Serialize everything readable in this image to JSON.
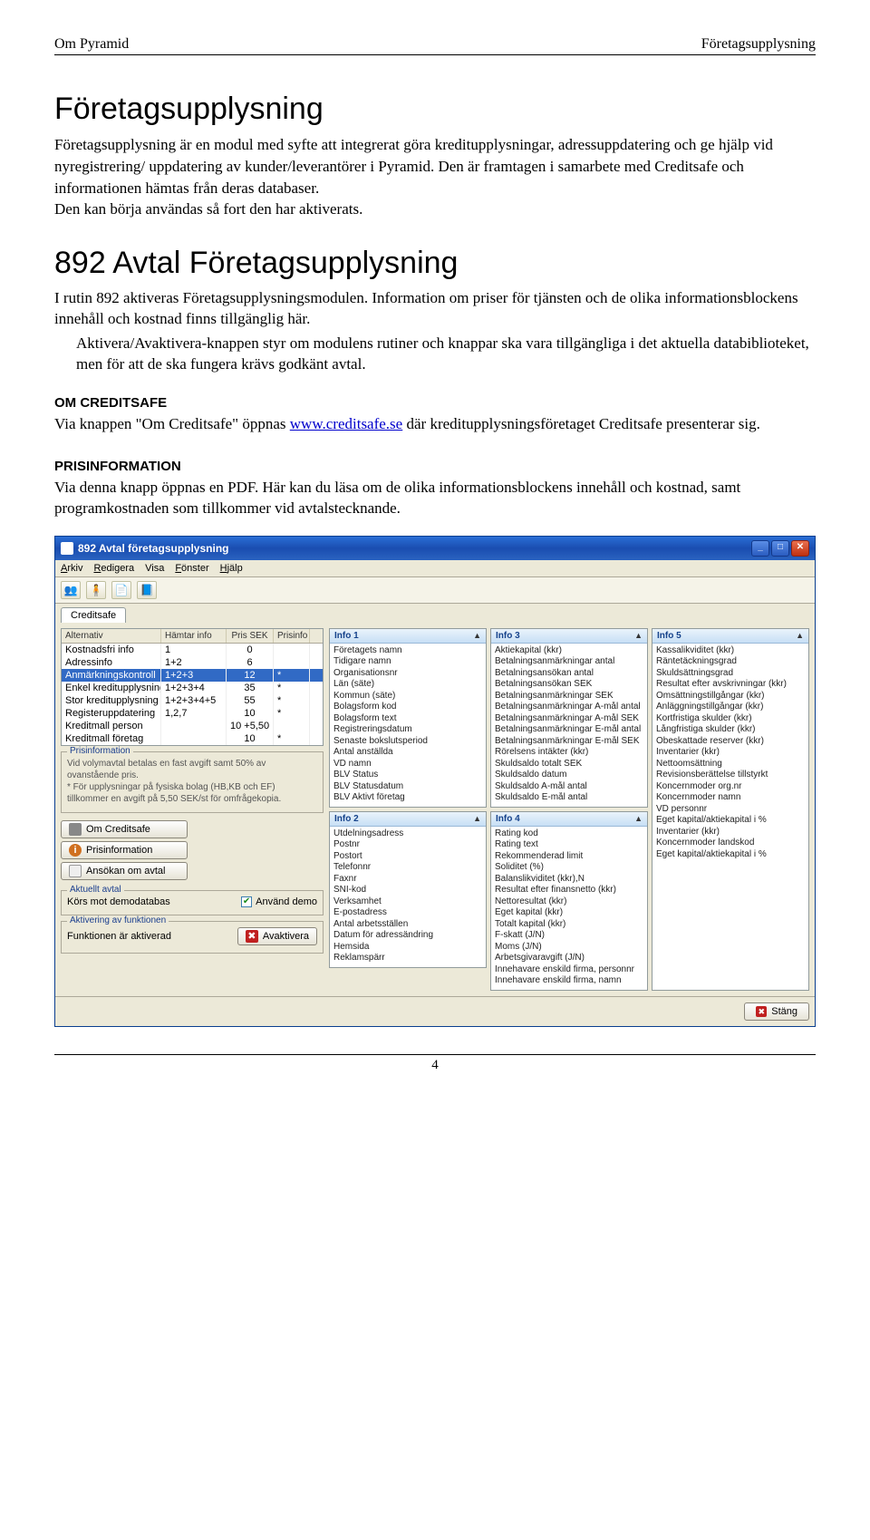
{
  "header": {
    "left": "Om Pyramid",
    "right": "Företagsupplysning"
  },
  "h1": "Företagsupplysning",
  "intro": "Företagsupplysning är en modul med syfte att integrerat göra kreditupplysningar, adressuppdatering och ge hjälp vid nyregistrering/ uppdatering av kunder/leverantörer i Pyramid. Den är framtagen i samarbete med Creditsafe och informationen hämtas från deras databaser.",
  "intro2": "Den kan börja användas så fort den har aktiverats.",
  "h2": "892 Avtal Företagsupplysning",
  "p892": "I rutin 892 aktiveras Företagsupplysningsmodulen. Information om priser för tjänsten och de olika informationsblockens innehåll och kostnad finns tillgänglig här.",
  "p892b": "Aktivera/Avaktivera-knappen styr om modulens rutiner och knappar ska vara tillgängliga i det aktuella databiblioteket, men för att de ska fungera krävs godkänt avtal.",
  "om_head": "OM CREDITSAFE",
  "om_text_pre": "Via knappen \"Om Creditsafe\" öppnas ",
  "om_link": "www.creditsafe.se",
  "om_text_post": " där kreditupplysningsföretaget Creditsafe presenterar sig.",
  "pris_head": "PRISINFORMATION",
  "pris_text": "Via denna knapp öppnas en PDF. Här kan du läsa om de olika informationsblockens innehåll och kostnad, samt programkostnaden som tillkommer vid avtalstecknande.",
  "window": {
    "title": "892 Avtal företagsupplysning",
    "menus": [
      "Arkiv",
      "Redigera",
      "Visa",
      "Fönster",
      "Hjälp"
    ],
    "tab": "Creditsafe",
    "grid_headers": [
      "Alternativ",
      "Hämtar info",
      "Pris SEK",
      "Prisinfo"
    ],
    "grid_rows": [
      {
        "c": [
          "Kostnadsfri info",
          "1",
          "0",
          ""
        ]
      },
      {
        "c": [
          "Adressinfo",
          "1+2",
          "6",
          ""
        ]
      },
      {
        "c": [
          "Anmärkningskontroll",
          "1+2+3",
          "12",
          "*"
        ],
        "sel": true
      },
      {
        "c": [
          "Enkel kreditupplysning",
          "1+2+3+4",
          "35",
          "*"
        ]
      },
      {
        "c": [
          "Stor kreditupplysning",
          "1+2+3+4+5",
          "55",
          "*"
        ]
      },
      {
        "c": [
          "Registeruppdatering",
          "1,2,7",
          "10",
          "*"
        ]
      },
      {
        "c": [
          "Kreditmall person",
          "",
          "10 +5,50",
          ""
        ]
      },
      {
        "c": [
          "Kreditmall företag",
          "",
          "10",
          "*"
        ]
      }
    ],
    "prisinfo_legend": "Prisinformation",
    "prisinfo_text": "Vid volymavtal betalas en fast avgift samt 50% av ovanstående pris.\n* För upplysningar på fysiska bolag (HB,KB och EF) tillkommer en avgift på 5,50 SEK/st för omfrågekopia.",
    "btn_om": "Om Creditsafe",
    "btn_pris": "Prisinformation",
    "btn_ansokan": "Ansökan om avtal",
    "aktuellt_legend": "Aktuellt avtal",
    "aktuellt_text": "Körs mot demodatabas",
    "anvand_demo": "Använd demo",
    "aktivering_legend": "Aktivering av funktionen",
    "aktivering_text": "Funktionen är aktiverad",
    "btn_avaktivera": "Avaktivera",
    "close": "Stäng",
    "info1": {
      "title": "Info 1",
      "items": [
        "Företagets namn",
        "Tidigare namn",
        "Organisationsnr",
        "Län (säte)",
        "Kommun (säte)",
        "Bolagsform kod",
        "Bolagsform text",
        "Registreringsdatum",
        "Senaste bokslutsperiod",
        "Antal anställda",
        "VD namn",
        "BLV Status",
        "BLV Statusdatum",
        "BLV Aktivt företag"
      ]
    },
    "info2": {
      "title": "Info 2",
      "items": [
        "Utdelningsadress",
        "Postnr",
        "Postort",
        "Telefonnr",
        "Faxnr",
        "SNI-kod",
        "Verksamhet",
        "E-postadress",
        "Antal arbetsställen",
        "Datum för adressändring",
        "Hemsida",
        "Reklamspärr"
      ]
    },
    "info3": {
      "title": "Info 3",
      "items": [
        "Aktiekapital (kkr)",
        "Betalningsanmärkningar antal",
        "Betalningsansökan antal",
        "Betalningsansökan SEK",
        "Betalningsanmärkningar SEK",
        "Betalningsanmärkningar A-mål antal",
        "Betalningsanmärkningar A-mål SEK",
        "Betalningsanmärkningar E-mål antal",
        "Betalningsanmärkningar E-mål SEK",
        "Rörelsens intäkter (kkr)",
        "Skuldsaldo totalt SEK",
        "Skuldsaldo datum",
        "Skuldsaldo A-mål antal",
        "Skuldsaldo E-mål antal"
      ]
    },
    "info4": {
      "title": "Info 4",
      "items": [
        "Rating kod",
        "Rating text",
        "Rekommenderad limit",
        "Soliditet (%)",
        "Balanslikviditet (kkr),N",
        "Resultat efter finansnetto (kkr)",
        "Nettoresultat (kkr)",
        "Eget kapital (kkr)",
        "Totalt kapital (kkr)",
        "F-skatt (J/N)",
        "Moms (J/N)",
        "Arbetsgivaravgift (J/N)",
        "Innehavare enskild firma, personnr",
        "Innehavare enskild firma, namn"
      ]
    },
    "info5": {
      "title": "Info 5",
      "items": [
        "Kassalikviditet (kkr)",
        "Räntetäckningsgrad",
        "Skuldsättningsgrad",
        "Resultat efter avskrivningar (kkr)",
        "Omsättningstillgångar (kkr)",
        "Anläggningstillgångar (kkr)",
        "Kortfristiga skulder (kkr)",
        "Långfristiga skulder (kkr)",
        "Obeskattade reserver (kkr)",
        "Inventarier (kkr)",
        "Nettoomsättning",
        "Revisionsberättelse tillstyrkt",
        "Koncernmoder org.nr",
        "Koncernmoder namn",
        "VD personnr",
        "Eget kapital/aktiekapital i %",
        "Inventarier (kkr)",
        "Koncernmoder landskod",
        "Eget kapital/aktiekapital i %"
      ]
    }
  },
  "page_number": "4"
}
